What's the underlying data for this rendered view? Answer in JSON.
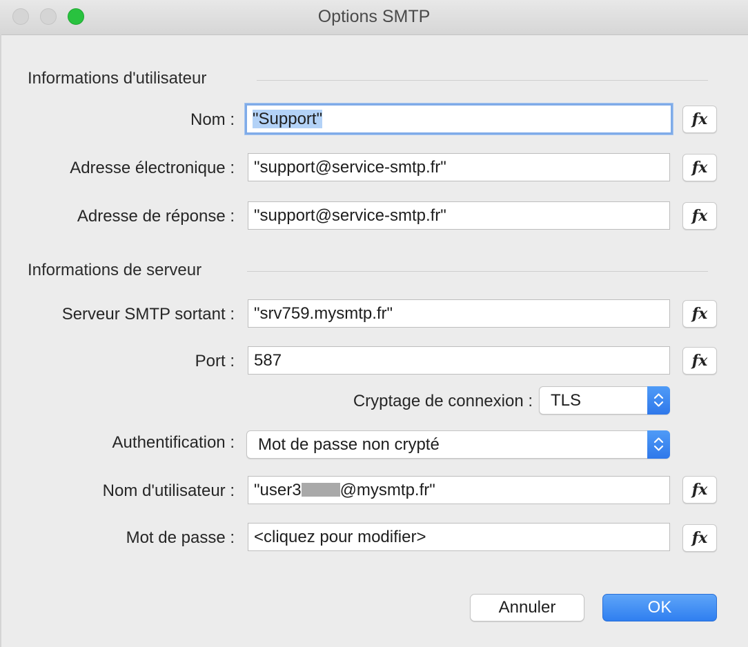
{
  "window": {
    "title": "Options SMTP"
  },
  "sections": {
    "user_info": "Informations d'utilisateur",
    "server_info": "Informations de serveur"
  },
  "fields": {
    "nom": {
      "label": "Nom :",
      "value": "\"Support\""
    },
    "email": {
      "label": "Adresse électronique :",
      "value": "\"support@service-smtp.fr\""
    },
    "reply": {
      "label": "Adresse de réponse :",
      "value": "\"support@service-smtp.fr\""
    },
    "smtp_server": {
      "label": "Serveur SMTP sortant :",
      "value": "\"srv759.mysmtp.fr\""
    },
    "port": {
      "label": "Port :",
      "value": "587"
    },
    "encryption": {
      "label": "Cryptage de connexion :",
      "value": "TLS"
    },
    "auth": {
      "label": "Authentification :",
      "value": "Mot de passe non crypté"
    },
    "username": {
      "label": "Nom d'utilisateur :",
      "value_prefix": "\"user3",
      "value_suffix": "@mysmtp.fr\""
    },
    "password": {
      "label": "Mot de passe :",
      "value": "<cliquez pour modifier>"
    }
  },
  "fx_label": "fx",
  "buttons": {
    "cancel": "Annuler",
    "ok": "OK"
  },
  "colors": {
    "accent": "#2f7ff0",
    "focus_ring": "#7fabe8",
    "selection": "#b3d2f7"
  }
}
